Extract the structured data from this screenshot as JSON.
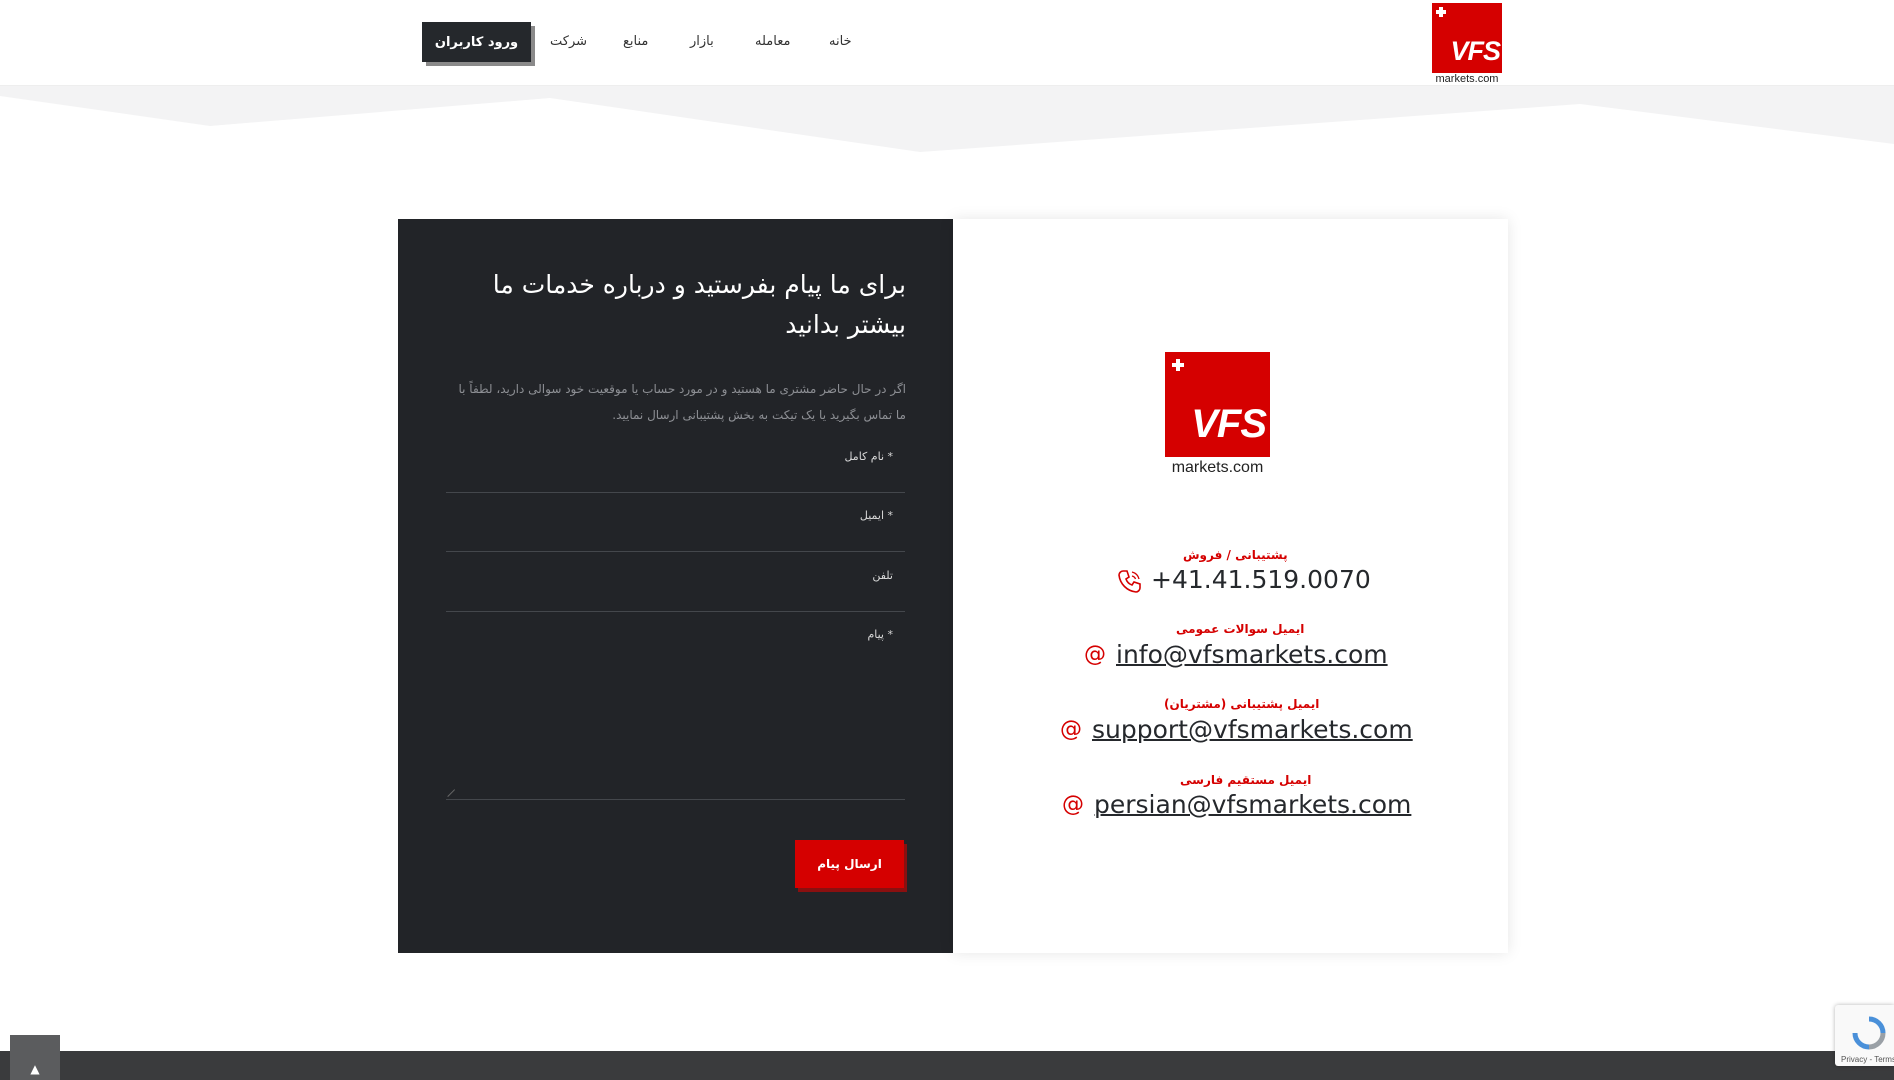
{
  "brand": {
    "logo_letters": "VFS",
    "logo_domain": "markets.com",
    "logo_color": "#d50000"
  },
  "nav": {
    "items": [
      "خانه",
      "معامله",
      "بازار",
      "منابع",
      "شرکت"
    ],
    "login_label": "ورود کاربران"
  },
  "form": {
    "title": "برای ما پیام بفرستید و درباره خدمات ما بیشتر بدانید",
    "description": "اگر در حال حاضر مشتری ما هستید و در مورد حساب یا موقعیت خود سوالی دارید، لطفاً با ما تماس بگیرید یا یک تیکت به بخش پشتیبانی ارسال نمایید.",
    "fields": {
      "full_name": "* نام کامل",
      "email": "* ایمیل",
      "phone": "تلفن",
      "message": "* پیام"
    },
    "submit_label": "ارسال پیام"
  },
  "contact": {
    "phone_label": "پشتیبانی / فروش",
    "phone": "+41.41.519.0070",
    "general_label": "ایمیل سوالات عمومی",
    "general_email": "info@vfsmarkets.com",
    "support_label": "ایمیل پشتیبانی (مشتریان)",
    "support_email": "support@vfsmarkets.com",
    "persian_label": "ایمیل مستقیم فارسی",
    "persian_email": "persian@vfsmarkets.com",
    "at_symbol": "@"
  },
  "recaptcha": {
    "text": "Privacy - Terms"
  },
  "scroll_top": {
    "icon": "chevron-up-icon"
  }
}
